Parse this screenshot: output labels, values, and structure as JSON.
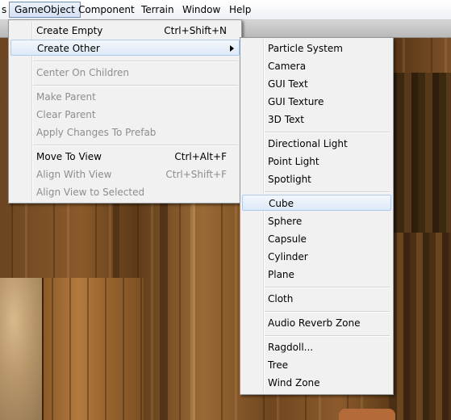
{
  "menubar": {
    "items": [
      {
        "label": "s"
      },
      {
        "label": "GameObject"
      },
      {
        "label": "Component"
      },
      {
        "label": "Terrain"
      },
      {
        "label": "Window"
      },
      {
        "label": "Help"
      }
    ]
  },
  "gameobject_menu": {
    "create_empty": {
      "label": "Create Empty",
      "shortcut": "Ctrl+Shift+N"
    },
    "create_other": {
      "label": "Create Other"
    },
    "center_on_children": {
      "label": "Center On Children"
    },
    "make_parent": {
      "label": "Make Parent"
    },
    "clear_parent": {
      "label": "Clear Parent"
    },
    "apply_changes": {
      "label": "Apply Changes To Prefab"
    },
    "move_to_view": {
      "label": "Move To View",
      "shortcut": "Ctrl+Alt+F"
    },
    "align_with_view": {
      "label": "Align With View",
      "shortcut": "Ctrl+Shift+F"
    },
    "align_view_to_selected": {
      "label": "Align View to Selected"
    }
  },
  "create_other_menu": {
    "items": [
      "Particle System",
      "Camera",
      "GUI Text",
      "GUI Texture",
      "3D Text",
      "Directional Light",
      "Point Light",
      "Spotlight",
      "Cube",
      "Sphere",
      "Capsule",
      "Cylinder",
      "Plane",
      "Cloth",
      "Audio Reverb Zone",
      "Ragdoll...",
      "Tree",
      "Wind Zone"
    ],
    "highlighted": "Cube"
  },
  "icons": {
    "submenu_arrow": "chevron-right-icon"
  }
}
